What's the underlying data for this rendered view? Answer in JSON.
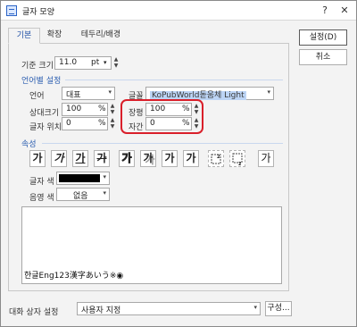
{
  "window": {
    "title": "글자 모양",
    "help": "?",
    "close": "✕"
  },
  "tabs": [
    {
      "label": "기본"
    },
    {
      "label": "확장"
    },
    {
      "label": "테두리/배경"
    }
  ],
  "buttons": {
    "ok": "설정(D)",
    "cancel": "취소",
    "configure": "구성..."
  },
  "base_size": {
    "label": "기준 크기",
    "value": "11.0",
    "unit": "pt"
  },
  "lang_section": {
    "title": "언어별 설정"
  },
  "language": {
    "label": "언어",
    "value": "대표"
  },
  "font": {
    "label": "글꼴",
    "value": "KoPubWorld돋움체 Light"
  },
  "relative_size": {
    "label": "상대크기",
    "value": "100",
    "unit": "%"
  },
  "char_position": {
    "label": "글자 위치",
    "value": "0",
    "unit": "%"
  },
  "width_ratio": {
    "label": "장평",
    "value": "100",
    "unit": "%"
  },
  "char_spacing": {
    "label": "자간",
    "value": "0",
    "unit": "%"
  },
  "attr_section": {
    "title": "속성"
  },
  "attr_buttons": [
    "가",
    "가",
    "가",
    "가",
    "가",
    "가",
    "가",
    "가"
  ],
  "text_color": {
    "label": "글자 색",
    "value_color": "#000000"
  },
  "shade_color": {
    "label": "음영 색",
    "value": "없음"
  },
  "preview": {
    "text": "한글Eng123漢字あいう※◉"
  },
  "dialog_setting": {
    "label": "대화 상자 설정",
    "value": "사용자 지정"
  },
  "colors": {
    "accent": "#2a5db0",
    "highlight_box": "#d91f2a"
  }
}
